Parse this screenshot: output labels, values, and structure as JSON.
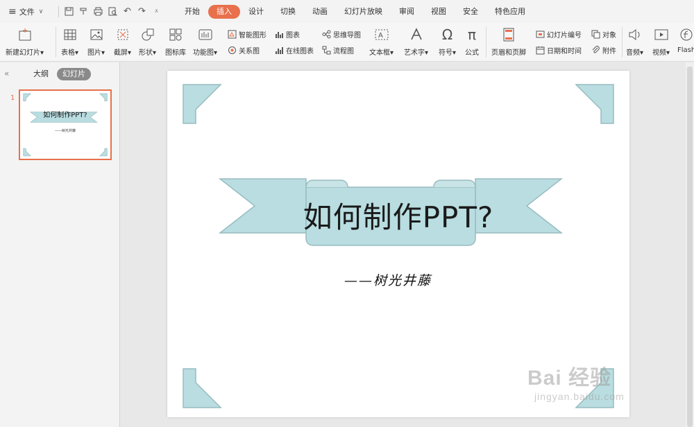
{
  "menu": {
    "file_label": "文件",
    "tabs": [
      "开始",
      "插入",
      "设计",
      "切换",
      "动画",
      "幻灯片放映",
      "审阅",
      "视图",
      "安全",
      "特色应用"
    ],
    "active_tab": "插入"
  },
  "ribbon": {
    "new_slide": "新建幻灯片",
    "table": "表格",
    "picture": "图片",
    "screenshot": "截屏",
    "shape": "形状",
    "icon_lib": "图标库",
    "function_chart": "功能图",
    "smart_shape": "智能图形",
    "chart": "图表",
    "relation_chart": "关系图",
    "online_chart": "在线图表",
    "mind_map": "思维导图",
    "flow_chart": "流程图",
    "text_box": "文本框",
    "art_text": "艺术字",
    "symbol": "符号",
    "formula": "公式",
    "header_footer": "页眉和页脚",
    "slide_number": "幻灯片编号",
    "object": "对象",
    "date_time": "日期和时间",
    "attachment": "附件",
    "audio": "音频",
    "video": "视频",
    "flash": "Flash"
  },
  "panel": {
    "outline_tab": "大纲",
    "slides_tab": "幻灯片",
    "slide_number": "1",
    "thumb_title": "如何制作PPT?",
    "thumb_sub": "——树光井藤"
  },
  "slide": {
    "title": "如何制作PPT?",
    "subtitle": "——树光井藤"
  },
  "colors": {
    "accent": "#e8704b",
    "ribbon_fill": "#b9dde0",
    "ribbon_dark": "#9fb3b5"
  },
  "watermark": {
    "brand": "Bai 经验",
    "url": "jingyan.baidu.com"
  }
}
